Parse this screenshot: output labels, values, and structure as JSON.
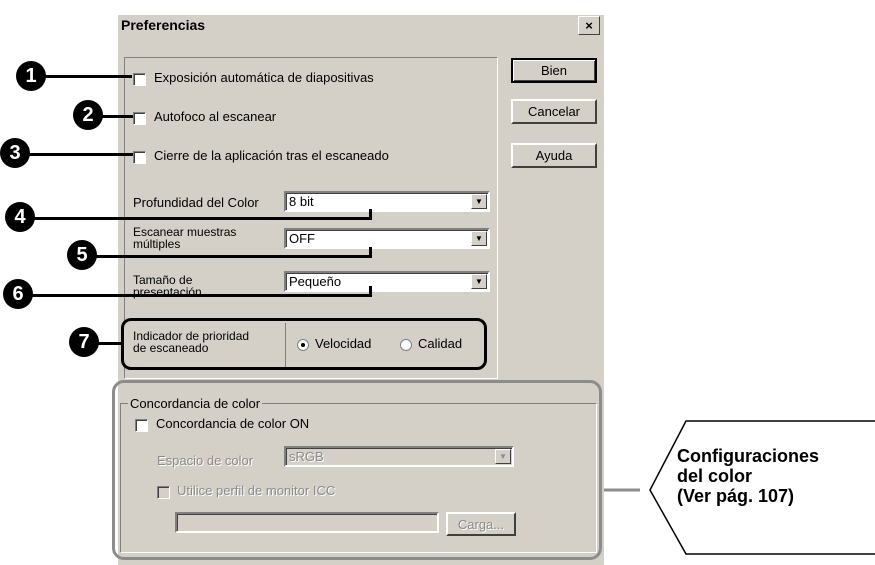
{
  "dialog": {
    "title": "Preferencias",
    "close_label": "×"
  },
  "buttons": {
    "ok": "Bien",
    "cancel": "Cancelar",
    "help": "Ayuda"
  },
  "options": {
    "auto_exposure": "Exposición automática de diapositivas",
    "autofocus": "Autofoco al escanear",
    "close_app": "Cierre de la aplicación tras el escaneado"
  },
  "settings": {
    "color_depth_label": "Profundidad del Color",
    "color_depth_value": "8 bit",
    "multi_sample_label_1": "Escanear muestras",
    "multi_sample_label_2": "múltiples",
    "multi_sample_value": "OFF",
    "preview_size_label_1": "Tamaño de",
    "preview_size_label_2": "presentación",
    "preview_size_value": "Pequeño"
  },
  "priority": {
    "label_1": "Indicador de prioridad",
    "label_2": "de escaneado",
    "speed": "Velocidad",
    "quality": "Calidad",
    "selected": "Velocidad"
  },
  "color_matching": {
    "group_title": "Concordancia de color",
    "enable_label": "Concordancia de color ON",
    "color_space_label": "Espacio de color",
    "color_space_value": "sRGB",
    "icc_label": "Utilice perfil de monitor ICC",
    "icc_path": "",
    "load_button": "Carga..."
  },
  "callouts": {
    "n1": "1",
    "n2": "2",
    "n3": "3",
    "n4": "4",
    "n5": "5",
    "n6": "6",
    "n7": "7",
    "settings_1": "Configuraciones",
    "settings_2": "del color",
    "settings_3": "(Ver pág. 107)"
  }
}
